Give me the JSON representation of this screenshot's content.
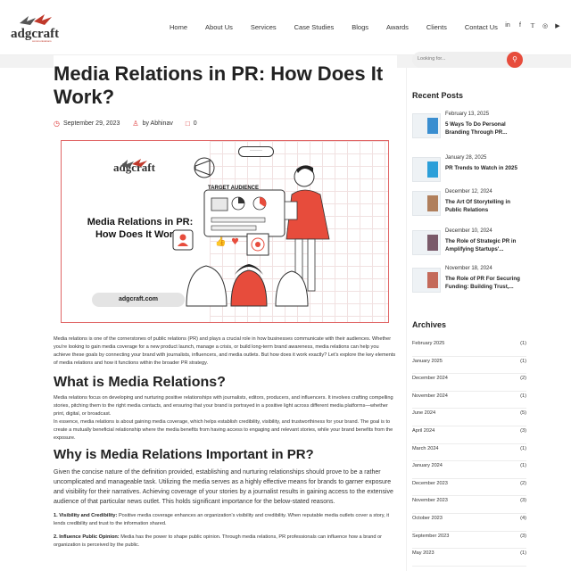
{
  "header": {
    "logo": "adgcraft",
    "logo_sub": "communications",
    "nav": [
      "Home",
      "About Us",
      "Services",
      "Case Studies",
      "Blogs",
      "Awards",
      "Clients",
      "Contact Us"
    ],
    "social": [
      "in",
      "f",
      "t",
      "ig",
      "yt"
    ]
  },
  "article": {
    "title": "Media Relations in PR: How Does It Work?",
    "date": "September 29, 2023",
    "author": "by Abhinav",
    "comments": "0",
    "hero": {
      "logo": "adgcraft",
      "title": "Media Relations in PR: How Does It Work?",
      "url": "adgcraft.com",
      "target_label": "TARGET AUDIENCE"
    },
    "intro": "Media relations is one of the cornerstones of public relations (PR) and plays a crucial role in how businesses communicate with their audiences. Whether you're looking to gain media coverage for a new product launch, manage a crisis, or build long-term brand awareness, media relations can help you achieve these goals by connecting your brand with journalists, influencers, and media outlets. But how does it work exactly? Let's explore the key elements of media relations and how it functions within the broader PR strategy.",
    "h2_1": "What is Media Relations?",
    "p1a": "Media relations focus on developing and nurturing positive relationships with journalists, editors, producers, and influencers. It involves crafting compelling stories, pitching them to the right media contacts, and ensuring that your brand is portrayed in a positive light across different media platforms—whether print, digital, or broadcast.",
    "p1b": "In essence, media relations is about gaining media coverage, which helps establish credibility, visibility, and trustworthiness for your brand. The goal is to create a mutually beneficial relationship where the media benefits from having access to engaging and relevant stories, while your brand benefits from the exposure.",
    "h2_2": "Why is Media Relations Important in PR?",
    "p2": "Given the concise nature of the definition provided, establishing and nurturing relationships should prove to be a rather uncomplicated and manageable task. Utilizing the media serves as a highly effective means for brands to garner exposure and visibility for their narratives. Achieving coverage of your stories by a journalist results in gaining access to the extensive audience of that particular news outlet. This holds significant importance for the below-stated reasons.",
    "pt1_label": "1. Visibility and Credibility:",
    "pt1": " Positive media coverage enhances an organization's visibility and credibility. When reputable media outlets cover a story, it lends credibility and trust to the information shared.",
    "pt2_label": "2. Influence Public Opinion:",
    "pt2": " Media has the power to shape public opinion. Through media relations, PR professionals can influence how a brand or organization is perceived by the public."
  },
  "sidebar": {
    "search_placeholder": "Looking for...",
    "recent_heading": "Recent Posts",
    "posts": [
      {
        "date": "February 13, 2025",
        "title": "5 Ways To Do Personal Branding Through PR..."
      },
      {
        "date": "January 28, 2025",
        "title": "PR Trends to Watch in 2025"
      },
      {
        "date": "December 12, 2024",
        "title": "The Art Of Storytelling in Public Relations"
      },
      {
        "date": "December 10, 2024",
        "title": "The Role of Strategic PR in Amplifying Startups'..."
      },
      {
        "date": "November 18, 2024",
        "title": "The Role of PR For Securing Funding: Building Trust,..."
      }
    ],
    "archives_heading": "Archives",
    "archives": [
      {
        "month": "February 2025",
        "count": "(1)"
      },
      {
        "month": "January 2025",
        "count": "(1)"
      },
      {
        "month": "December 2024",
        "count": "(2)"
      },
      {
        "month": "November 2024",
        "count": "(1)"
      },
      {
        "month": "June 2024",
        "count": "(5)"
      },
      {
        "month": "April 2024",
        "count": "(3)"
      },
      {
        "month": "March 2024",
        "count": "(1)"
      },
      {
        "month": "January 2024",
        "count": "(1)"
      },
      {
        "month": "December 2023",
        "count": "(2)"
      },
      {
        "month": "November 2023",
        "count": "(3)"
      },
      {
        "month": "October 2023",
        "count": "(4)"
      },
      {
        "month": "September 2023",
        "count": "(3)"
      },
      {
        "month": "May 2023",
        "count": "(1)"
      }
    ]
  },
  "colors": {
    "accent": "#e74c3c",
    "hero_border": "#e06666"
  },
  "icons": [
    "calendar-icon",
    "user-icon",
    "comment-icon",
    "search-icon"
  ]
}
